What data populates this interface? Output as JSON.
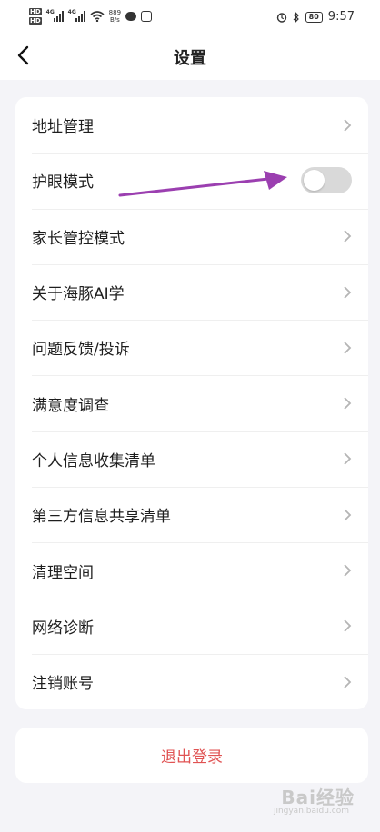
{
  "status": {
    "hd1": "HD",
    "hd2": "HD",
    "net1": "4G",
    "net2": "4G",
    "speed_value": "889",
    "speed_unit": "B/s",
    "battery": "80",
    "time": "9:57"
  },
  "nav": {
    "title": "设置"
  },
  "settings": {
    "items": [
      {
        "label": "地址管理"
      },
      {
        "label": "护眼模式"
      },
      {
        "label": "家长管控模式"
      },
      {
        "label": "关于海豚AI学"
      },
      {
        "label": "问题反馈/投诉"
      },
      {
        "label": "满意度调查"
      },
      {
        "label": "个人信息收集清单"
      },
      {
        "label": "第三方信息共享清单"
      },
      {
        "label": "清理空间"
      },
      {
        "label": "网络诊断"
      },
      {
        "label": "注销账号"
      }
    ],
    "eye_mode_on": false
  },
  "logout": {
    "label": "退出登录"
  },
  "watermark": {
    "text": "Bai经验",
    "sub": "jingyan.baidu.com"
  },
  "colors": {
    "logout": "#e05353",
    "toggle_off": "#d9d9d9",
    "annotation_arrow": "#9b3fb0"
  }
}
